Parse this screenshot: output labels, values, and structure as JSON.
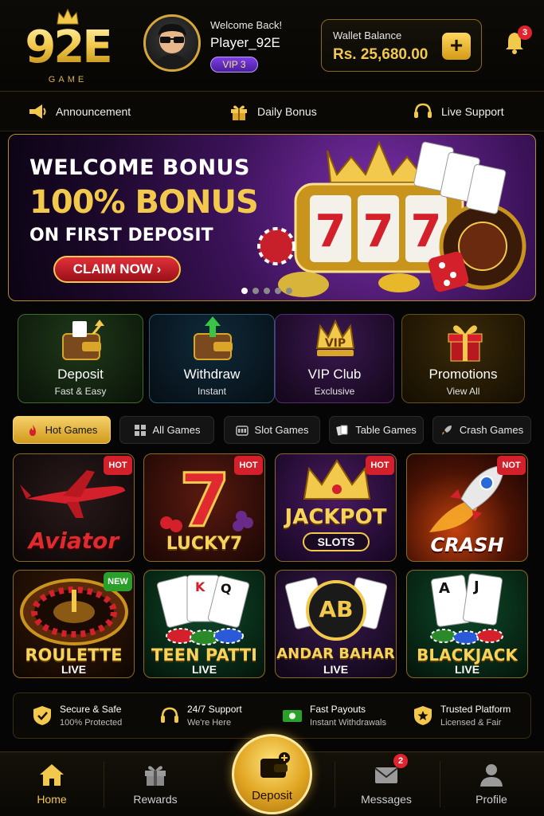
{
  "brand": {
    "logo_text": "92E",
    "logo_sub": "GAME"
  },
  "user": {
    "welcome": "Welcome Back!",
    "name": "Player_92E",
    "vip": "VIP 3"
  },
  "wallet": {
    "label": "Wallet Balance",
    "value": "Rs. 25,680.00"
  },
  "notifications": {
    "count": "3"
  },
  "quickbar": [
    {
      "label": "Announcement",
      "icon": "megaphone-icon"
    },
    {
      "label": "Daily Bonus",
      "icon": "gift-icon"
    },
    {
      "label": "Live Support",
      "icon": "headset-icon"
    }
  ],
  "banner": {
    "line1": "WELCOME BONUS",
    "line2": "100% BONUS",
    "line3": "ON FIRST DEPOSIT",
    "cta": "CLAIM NOW ›",
    "slide_count": 5,
    "active_slide": 1
  },
  "actions": [
    {
      "title": "Deposit",
      "sub": "Fast & Easy"
    },
    {
      "title": "Withdraw",
      "sub": "Instant"
    },
    {
      "title": "VIP Club",
      "sub": "Exclusive"
    },
    {
      "title": "Promotions",
      "sub": "View All"
    }
  ],
  "tabs": [
    {
      "label": "Hot Games",
      "active": true
    },
    {
      "label": "All Games"
    },
    {
      "label": "Slot Games"
    },
    {
      "label": "Table Games"
    },
    {
      "label": "Crash Games"
    }
  ],
  "games": [
    {
      "name": "Aviator",
      "tag": "HOT"
    },
    {
      "name": "LUCKY7",
      "tag": "HOT"
    },
    {
      "name": "JACKPOT",
      "sub": "SLOTS",
      "tag": "HOT"
    },
    {
      "name": "CRASH",
      "tag": "NOT"
    },
    {
      "name": "ROULETTE",
      "live": "LIVE",
      "tag": "NEW"
    },
    {
      "name": "TEEN PATTI",
      "live": "LIVE"
    },
    {
      "name": "ANDAR BAHAR",
      "badge": "AB",
      "live": "LIVE"
    },
    {
      "name": "BLACKJACK",
      "live": "LIVE"
    }
  ],
  "trust": [
    {
      "title": "Secure & Safe",
      "sub": "100% Protected"
    },
    {
      "title": "24/7 Support",
      "sub": "We're Here"
    },
    {
      "title": "Fast Payouts",
      "sub": "Instant Withdrawals"
    },
    {
      "title": "Trusted Platform",
      "sub": "Licensed & Fair"
    }
  ],
  "nav": [
    {
      "label": "Home",
      "active": true
    },
    {
      "label": "Rewards"
    },
    {
      "label": "Deposit"
    },
    {
      "label": "Messages",
      "badge": "2"
    },
    {
      "label": "Profile"
    }
  ],
  "colors": {
    "accent": "#f2c94c",
    "hot": "#d3202a",
    "new": "#2aa02a",
    "background": "#050505"
  }
}
